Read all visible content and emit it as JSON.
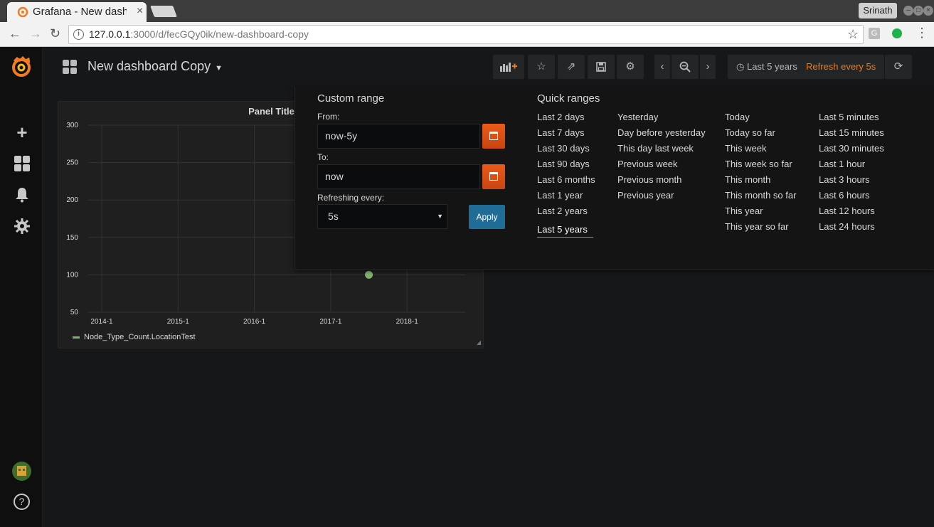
{
  "browser": {
    "tab_title": "Grafana - New dash",
    "tab_close": "×",
    "profile_name": "Srinath",
    "url_host": "127.0.0.1",
    "url_rest": ":3000/d/fecGQy0ik/new-dashboard-copy",
    "ext_letter": "G"
  },
  "dashboard": {
    "title": "New dashboard Copy",
    "time_range_label": "Last 5 years",
    "refresh_label": "Refresh every 5s"
  },
  "toolbar_icons": [
    "add-panel-icon",
    "star-icon",
    "share-icon",
    "save-icon",
    "settings-icon",
    "chevron-left-icon",
    "zoom-out-icon",
    "chevron-right-icon",
    "clock-icon",
    "refresh-icon"
  ],
  "panel": {
    "title": "Panel Title",
    "legend": "Node_Type_Count.LocationTest"
  },
  "chart_data": {
    "type": "scatter",
    "title": "Panel Title",
    "x_ticks": [
      "2014-1",
      "2015-1",
      "2016-1",
      "2017-1",
      "2018-1"
    ],
    "y_ticks": [
      300,
      250,
      200,
      150,
      100,
      50
    ],
    "ylim": [
      50,
      300
    ],
    "series": [
      {
        "name": "Node_Type_Count.LocationTest",
        "x": [
          "2017-07"
        ],
        "y": [
          100
        ],
        "color": "#7eb26d"
      }
    ],
    "grid": true,
    "legend_position": "bottom-left"
  },
  "picker": {
    "custom_range_title": "Custom range",
    "from_label": "From:",
    "from_value": "now-5y",
    "to_label": "To:",
    "to_value": "now",
    "refresh_label": "Refreshing every:",
    "refresh_value": "5s",
    "apply_label": "Apply",
    "quick_ranges_title": "Quick ranges",
    "quick_ranges": [
      [
        "Last 2 days",
        "Last 7 days",
        "Last 30 days",
        "Last 90 days",
        "Last 6 months",
        "Last 1 year",
        "Last 2 years",
        "Last 5 years"
      ],
      [
        "Yesterday",
        "Day before yesterday",
        "This day last week",
        "Previous week",
        "Previous month",
        "Previous year"
      ],
      [
        "Today",
        "Today so far",
        "This week",
        "This week so far",
        "This month",
        "This month so far",
        "This year",
        "This year so far"
      ],
      [
        "Last 5 minutes",
        "Last 15 minutes",
        "Last 30 minutes",
        "Last 1 hour",
        "Last 3 hours",
        "Last 6 hours",
        "Last 12 hours",
        "Last 24 hours"
      ]
    ],
    "active_range": "Last 5 years"
  },
  "colors": {
    "accent_orange": "#eb7b18",
    "apply_blue": "#1f6c96",
    "active_underline": "#33b5e5",
    "series_green": "#7eb26d"
  }
}
